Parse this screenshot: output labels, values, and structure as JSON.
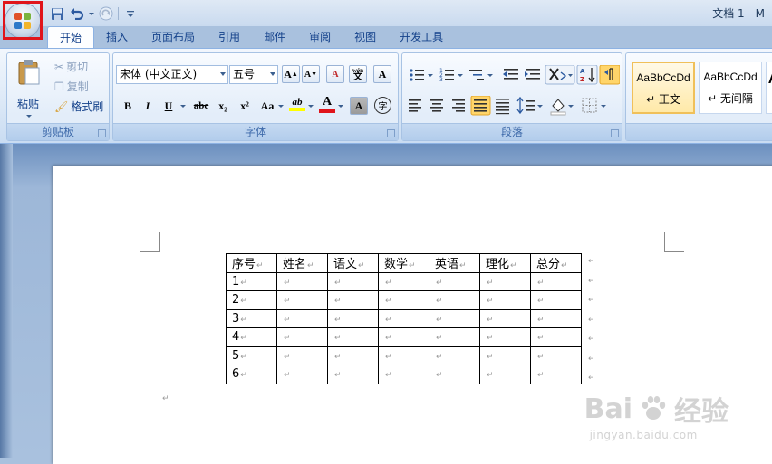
{
  "title_bar": {
    "title": "文档 1 - M"
  },
  "quick_access": {
    "save_icon": "save-icon",
    "undo_icon": "undo-icon",
    "redo_icon": "redo-icon",
    "customize_icon": "customize-qat-icon"
  },
  "tabs": [
    "开始",
    "插入",
    "页面布局",
    "引用",
    "邮件",
    "审阅",
    "视图",
    "开发工具"
  ],
  "active_tab": "开始",
  "clipboard": {
    "paste": "粘贴",
    "cut": "剪切",
    "copy": "复制",
    "format_painter": "格式刷",
    "group_label": "剪贴板"
  },
  "font": {
    "font_name": "宋体 (中文正文)",
    "font_size": "五号",
    "bold": "B",
    "italic": "I",
    "underline": "U",
    "strike": "abc",
    "subscript": "x₂",
    "superscript": "x²",
    "change_case": "Aa",
    "grow": "A",
    "shrink": "A",
    "clear": "A",
    "phonetic": "wén",
    "border": "A",
    "highlight": "ab",
    "color": "A",
    "shading": "A",
    "enclose": "字",
    "group_label": "字体"
  },
  "paragraph": {
    "group_label": "段落"
  },
  "styles": {
    "items": [
      {
        "sample": "AaBbCcDd",
        "name": "↵ 正文"
      },
      {
        "sample": "AaBbCcDd",
        "name": "↵ 无间隔"
      }
    ],
    "partial_sample": "A"
  },
  "table": {
    "headers": [
      "序号",
      "姓名",
      "语文",
      "数学",
      "英语",
      "理化",
      "总分"
    ],
    "rows": [
      [
        "1",
        "",
        "",
        "",
        "",
        "",
        ""
      ],
      [
        "2",
        "",
        "",
        "",
        "",
        "",
        ""
      ],
      [
        "3",
        "",
        "",
        "",
        "",
        "",
        ""
      ],
      [
        "4",
        "",
        "",
        "",
        "",
        "",
        ""
      ],
      [
        "5",
        "",
        "",
        "",
        "",
        "",
        ""
      ],
      [
        "6",
        "",
        "",
        "",
        "",
        "",
        ""
      ]
    ]
  },
  "paragraph_mark": "↵",
  "watermark": {
    "brand_left": "Bai",
    "brand_right": "经验",
    "url": "jingyan.baidu.com",
    "paw_icon": "paw-icon"
  },
  "colors": {
    "highlight_marker": "#e0141b",
    "font_color_bar": "#e0141b",
    "highlight_bar": "#ffff00"
  }
}
